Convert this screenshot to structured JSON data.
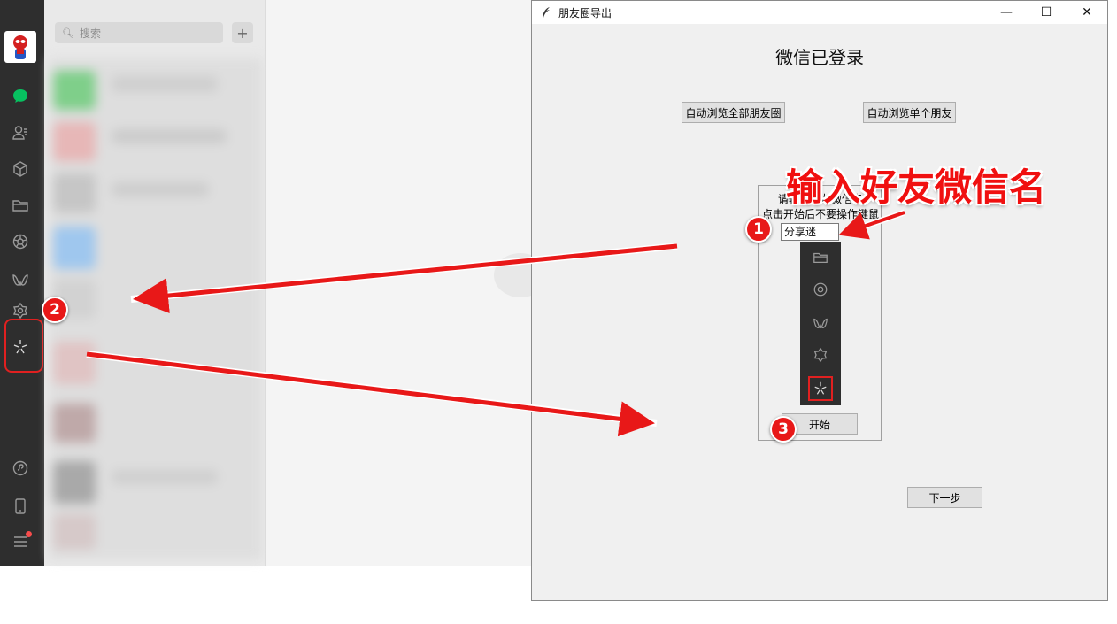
{
  "wechat": {
    "search_placeholder": "搜索",
    "add_label": "+",
    "sidebar_icons": [
      "chat-icon",
      "contacts-icon",
      "favorites-icon",
      "files-icon",
      "moments-icon",
      "channels-icon",
      "search-feature-icon",
      "mini-programs-icon",
      "miniapp-link-icon",
      "phone-icon",
      "menu-icon"
    ]
  },
  "export_window": {
    "title": "朋友圈导出",
    "controls": {
      "minimize": "—",
      "maximize": "☐",
      "close": "✕"
    },
    "headline": "微信已登录",
    "browse_all_button": "自动浏览全部朋友圈",
    "browse_single_button": "自动浏览单个朋友",
    "frame_line1": "请输入好友微信名",
    "frame_line2": "点击开始后不要操作键鼠",
    "friend_name_value": "分享迷",
    "start_button": "开始",
    "next_button": "下一步"
  },
  "annotations": {
    "callout": "输入好友微信名",
    "badge1": "1",
    "badge2": "2",
    "badge3": "3"
  },
  "colors": {
    "annotation_red": "#f01010",
    "sidebar_bg": "#2e2e2e",
    "wechat_green": "#07c160"
  }
}
